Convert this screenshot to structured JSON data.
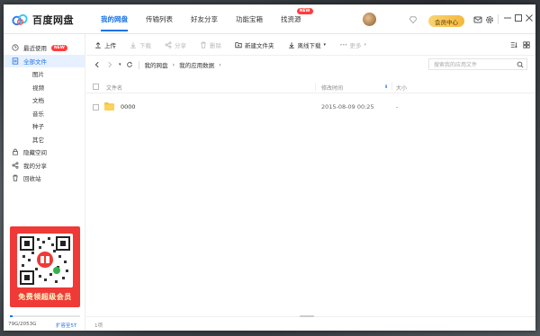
{
  "app": {
    "name": "百度网盘"
  },
  "nav": {
    "tabs": [
      {
        "label": "我的网盘"
      },
      {
        "label": "传输列表"
      },
      {
        "label": "好友分享"
      },
      {
        "label": "功能宝箱"
      },
      {
        "label": "找资源",
        "badge": "NEW"
      }
    ]
  },
  "header": {
    "vip_label": "会员中心"
  },
  "sidebar": {
    "items": [
      {
        "label": "最近使用",
        "badge": "NEW"
      },
      {
        "label": "全部文件"
      },
      {
        "label": "图片"
      },
      {
        "label": "视频"
      },
      {
        "label": "文档"
      },
      {
        "label": "音乐"
      },
      {
        "label": "种子"
      },
      {
        "label": "其它"
      },
      {
        "label": "隐藏空间"
      },
      {
        "label": "我的分享"
      },
      {
        "label": "回收站"
      }
    ],
    "promo_text": "免费领超级会员",
    "storage": {
      "text": "79G/2053G",
      "used_fraction": 0.038,
      "expand_label": "扩容至5T"
    }
  },
  "toolbar": {
    "upload": "上传",
    "download": "下载",
    "share": "分享",
    "delete": "删除",
    "new_folder": "新建文件夹",
    "offline_download": "离线下载",
    "more": "更多"
  },
  "path": {
    "crumbs": [
      "我的网盘",
      "我的应用数据"
    ],
    "search_placeholder": "搜索我的应用文件"
  },
  "table": {
    "columns": {
      "name": "文件名",
      "modified": "修改时间",
      "size": "大小"
    },
    "rows": [
      {
        "name": "0000",
        "modified": "2015-08-09 00:25",
        "size": "-"
      }
    ]
  },
  "footer": {
    "count": "1项"
  },
  "colors": {
    "accent": "#1a73e8",
    "promo": "#ef3a37",
    "badge": "#ff3d3d",
    "folder": "#f5c342",
    "vip": "#f5b83d"
  }
}
